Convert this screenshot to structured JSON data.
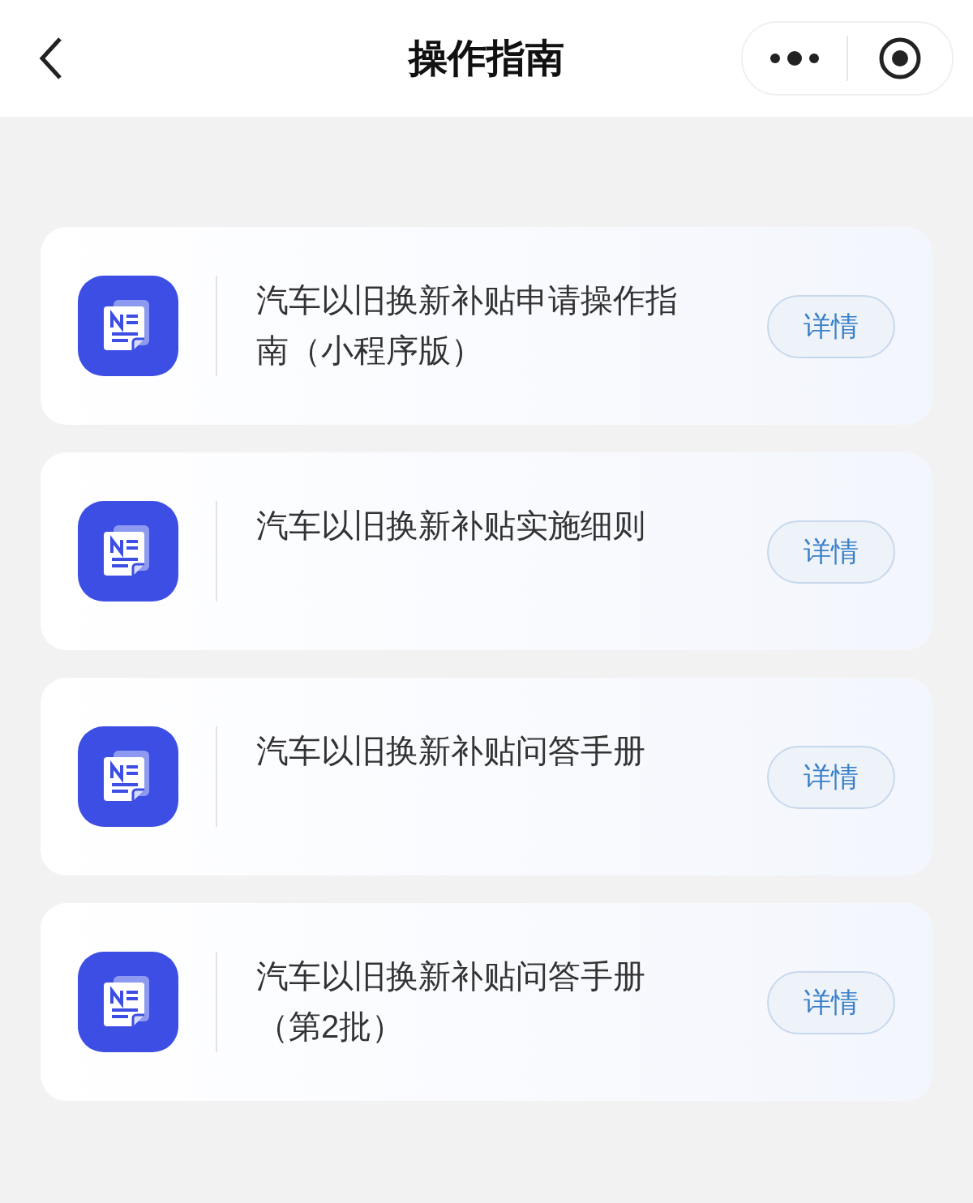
{
  "nav_bar": {
    "title": "操作指南"
  },
  "guides": [
    {
      "title": "汽车以旧换新补贴申请操作指南（小程序版）",
      "action": "详情"
    },
    {
      "title": "汽车以旧换新补贴实施细则",
      "action": "详情"
    },
    {
      "title": "汽车以旧换新补贴问答手册",
      "action": "详情"
    },
    {
      "title": "汽车以旧换新补贴问答手册（第2批）",
      "action": "详情"
    }
  ]
}
